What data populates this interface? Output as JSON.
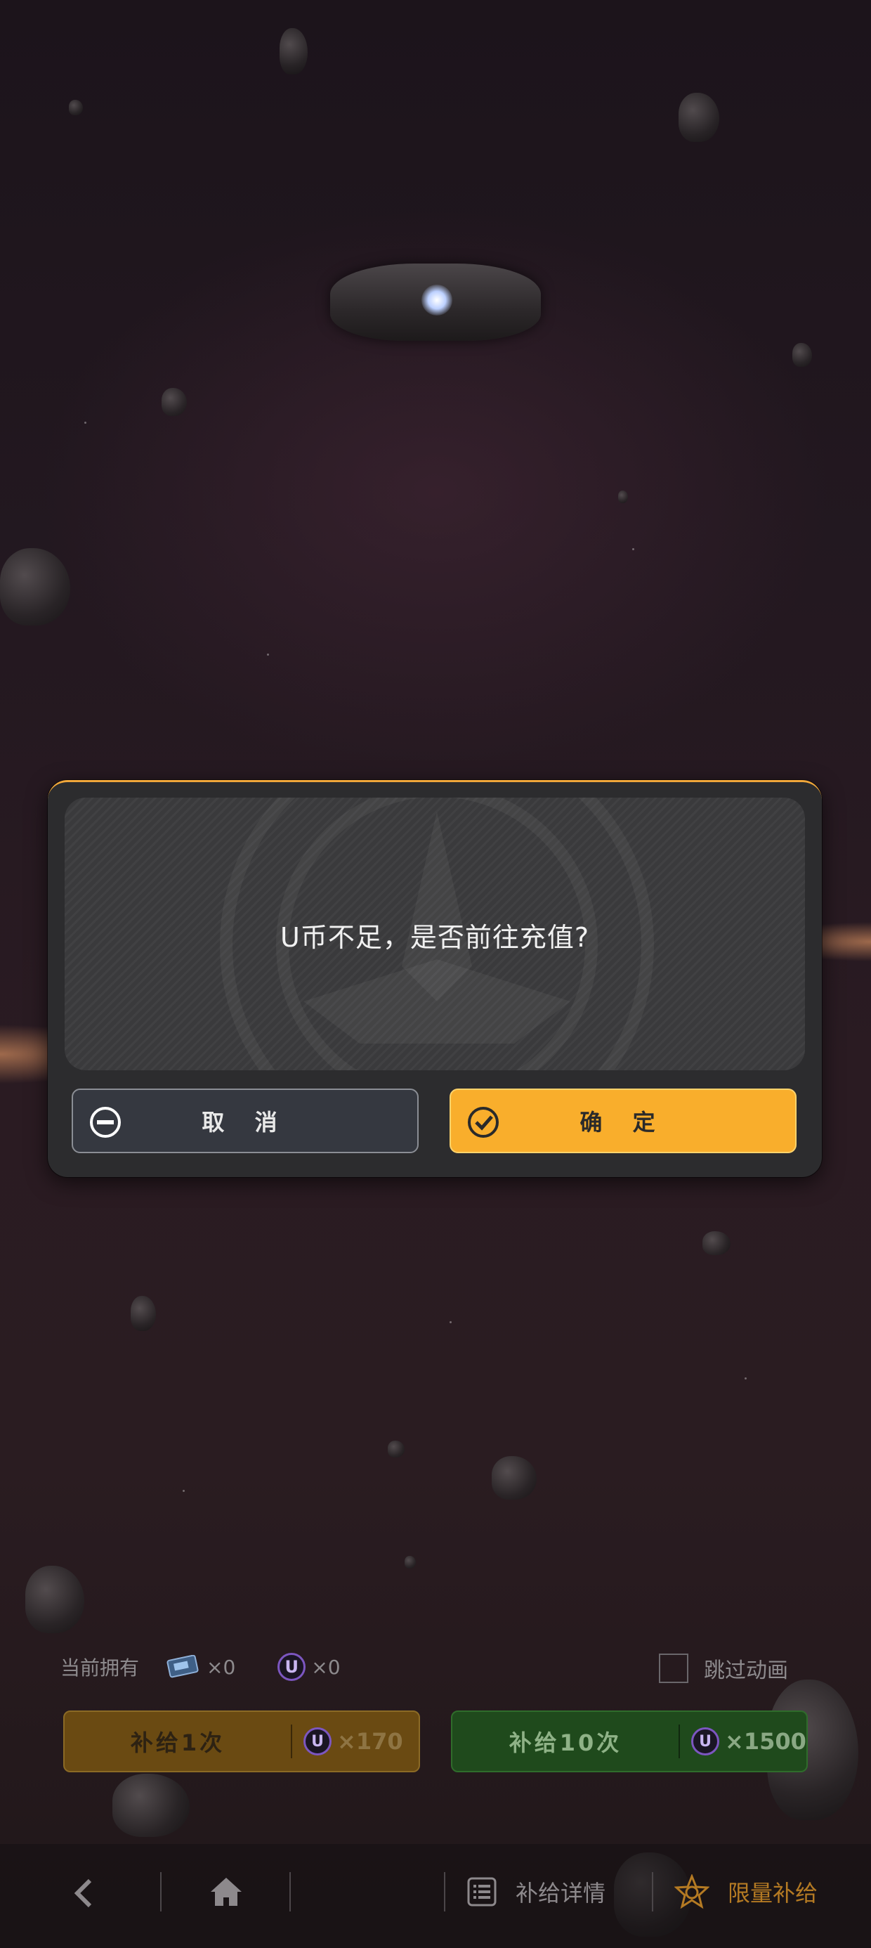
{
  "dialog": {
    "message": "U币不足，是否前往充值?",
    "cancel_label": "取 消",
    "confirm_label": "确 定"
  },
  "owned": {
    "label": "当前拥有",
    "ticket_count": "×0",
    "coin_symbol": "U",
    "coin_count": "×0"
  },
  "skip_animation": {
    "label": "跳过动画",
    "checked": false
  },
  "supply": {
    "once_label": "补给1次",
    "once_price": "×170",
    "ten_label": "补给10次",
    "ten_price": "×1500"
  },
  "nav": {
    "details_label": "补给详情",
    "limited_label": "限量补给"
  },
  "colors": {
    "accent_orange": "#f9ae2c",
    "supply_once_bg": "#6a4a12",
    "supply_ten_bg": "#1f4a1c",
    "coin_purple": "#7c56c0"
  }
}
